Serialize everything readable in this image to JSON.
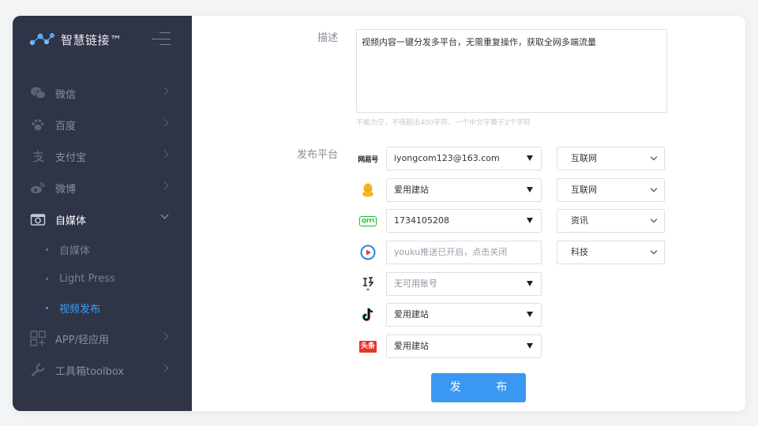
{
  "brand": {
    "name": "智慧链接™"
  },
  "sidebar": {
    "items": [
      {
        "label": "微信",
        "icon": "wechat-icon"
      },
      {
        "label": "百度",
        "icon": "paw-icon"
      },
      {
        "label": "支付宝",
        "icon": "alipay-icon"
      },
      {
        "label": "微博",
        "icon": "weibo-icon"
      },
      {
        "label": "自媒体",
        "icon": "camera-icon",
        "open": true
      },
      {
        "label": "APP/轻应用",
        "icon": "apps-icon"
      },
      {
        "label": "工具箱toolbox",
        "icon": "wrench-icon"
      }
    ],
    "subitems": [
      {
        "label": "自媒体"
      },
      {
        "label": "Light Press"
      },
      {
        "label": "视频发布",
        "active": true
      }
    ]
  },
  "form": {
    "desc_label": "描述",
    "desc_value": "视频内容一键分发多平台，无需重复操作，获取全网多端流量",
    "desc_hint": "不能为空，不得超出400字符，一个中文字算于2个字符",
    "platform_label": "发布平台",
    "platforms": [
      {
        "icon": "netease-icon",
        "icon_text": "网易号",
        "account": "iyongcom123@163.com",
        "category": "互联网"
      },
      {
        "icon": "qq-penguin-icon",
        "account": "爱用建站",
        "category": "互联网"
      },
      {
        "icon": "iqiyi-icon",
        "icon_text": "QIYI",
        "account": "1734105208",
        "category": "资讯"
      },
      {
        "icon": "youku-icon",
        "account_placeholder": "youku推送已开启，点击关闭",
        "category": "科技"
      },
      {
        "icon": "bilibili-style-icon",
        "account": "无可用账号"
      },
      {
        "icon": "tiktok-icon",
        "account": "爱用建站"
      },
      {
        "icon": "toutiao-icon",
        "icon_text": "头条",
        "account": "爱用建站"
      }
    ],
    "publish_label": "发 布"
  },
  "colors": {
    "sidebar_bg": "#2f3447",
    "accent": "#3a98f2",
    "active_text": "#3d9ef0"
  }
}
